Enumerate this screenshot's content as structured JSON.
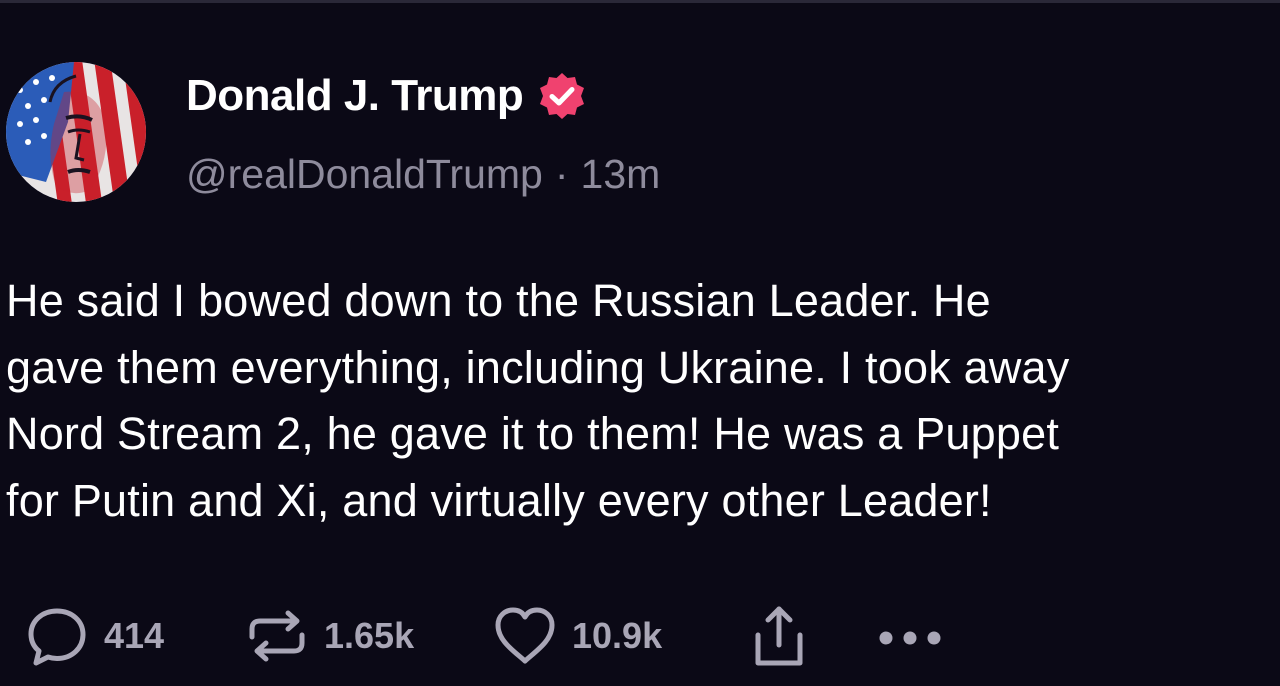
{
  "post": {
    "author": {
      "display_name": "Donald J. Trump",
      "handle": "@realDonaldTrump",
      "separator": "·",
      "time_ago": "13m",
      "verified": true,
      "verified_badge_color": "#f0426f",
      "avatar_icon": "flag-portrait-avatar"
    },
    "body_lines": [
      "He said I bowed down to the Russian Leader. He",
      "gave them everything, including Ukraine. I took away",
      "Nord Stream 2, he gave it to them! He was a Puppet",
      "for Putin and Xi, and virtually every other Leader!"
    ],
    "actions": {
      "reply": {
        "icon": "reply-icon",
        "count": "414"
      },
      "repost": {
        "icon": "repost-icon",
        "count": "1.65k"
      },
      "like": {
        "icon": "heart-icon",
        "count": "10.9k"
      },
      "share": {
        "icon": "share-icon"
      },
      "more": {
        "icon": "more-icon"
      }
    }
  },
  "colors": {
    "background": "#0b0916",
    "text_primary": "#ffffff",
    "text_secondary": "#8e8b9c",
    "action_gray": "#a9a6b6"
  }
}
